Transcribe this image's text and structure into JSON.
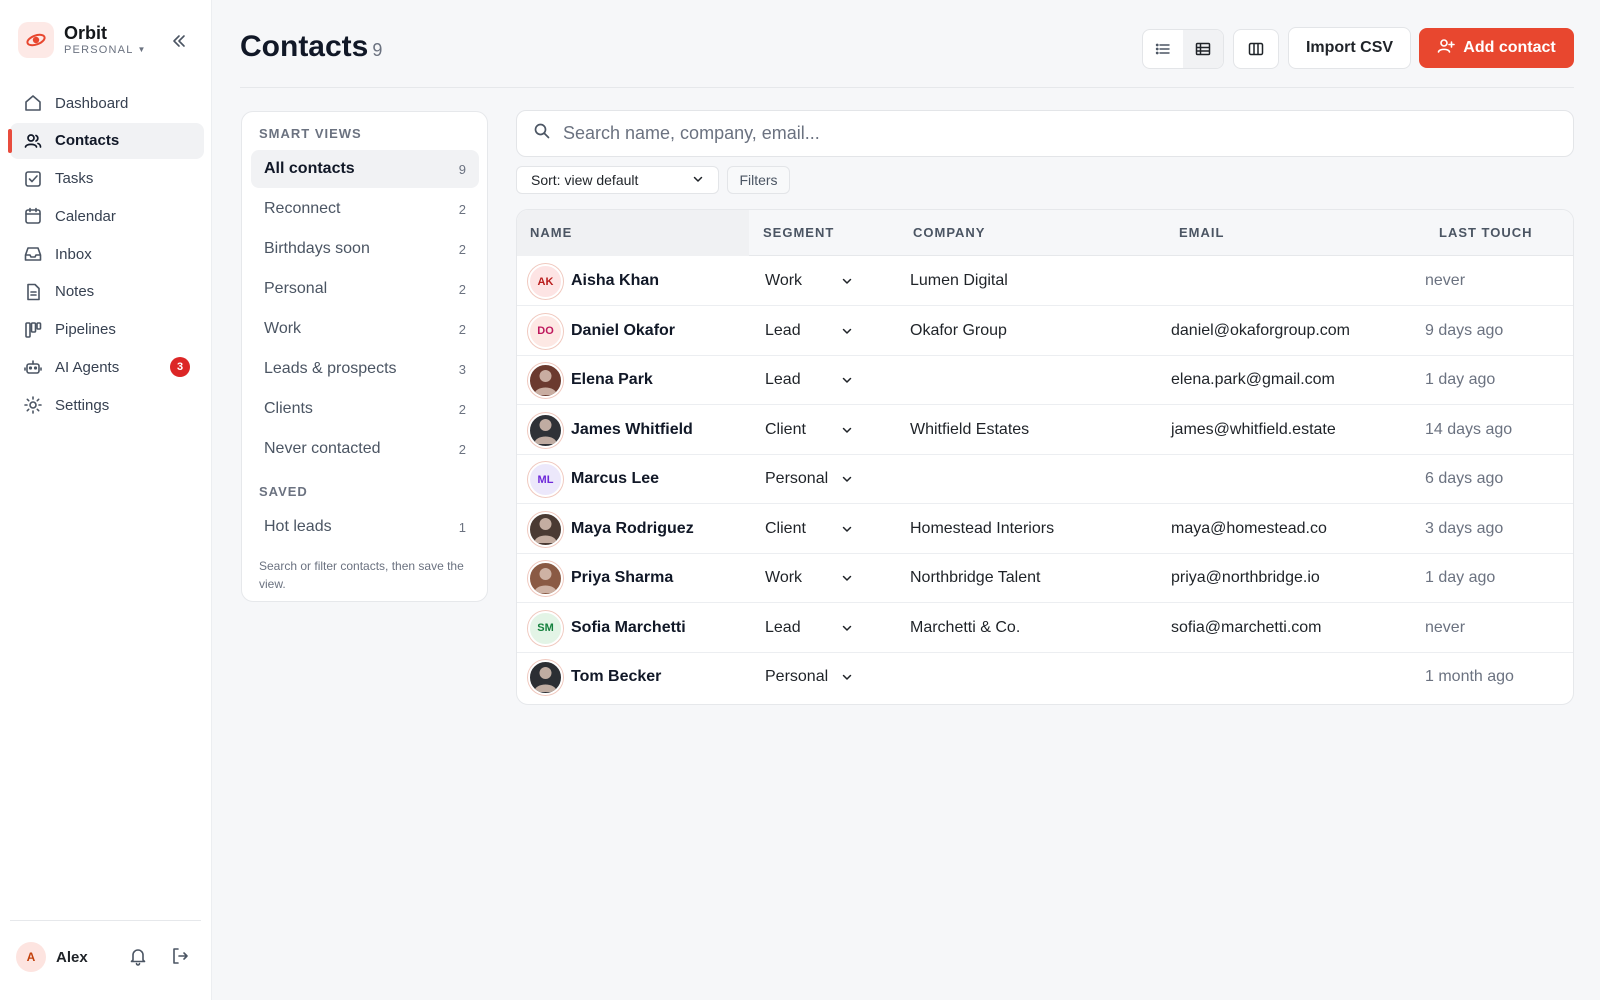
{
  "app": {
    "name": "Orbit",
    "workspace": "PERSONAL",
    "accent": "#e8472f"
  },
  "sidebar": {
    "items": [
      {
        "label": "Dashboard",
        "icon": "home-icon"
      },
      {
        "label": "Contacts",
        "icon": "users-icon",
        "active": true
      },
      {
        "label": "Tasks",
        "icon": "checkbox-icon"
      },
      {
        "label": "Calendar",
        "icon": "calendar-icon"
      },
      {
        "label": "Inbox",
        "icon": "inbox-icon"
      },
      {
        "label": "Notes",
        "icon": "note-icon"
      },
      {
        "label": "Pipelines",
        "icon": "kanban-icon"
      },
      {
        "label": "AI Agents",
        "icon": "robot-icon",
        "badge": "3"
      },
      {
        "label": "Settings",
        "icon": "gear-icon"
      }
    ],
    "user": {
      "initial": "A",
      "name": "Alex"
    }
  },
  "header": {
    "title": "Contacts",
    "count": "9",
    "import_label": "Import CSV",
    "add_label": "Add contact"
  },
  "views": {
    "smart_heading": "SMART VIEWS",
    "smart": [
      {
        "label": "All contacts",
        "count": "9",
        "active": true
      },
      {
        "label": "Reconnect",
        "count": "2"
      },
      {
        "label": "Birthdays soon",
        "count": "2"
      },
      {
        "label": "Personal",
        "count": "2"
      },
      {
        "label": "Work",
        "count": "2"
      },
      {
        "label": "Leads & prospects",
        "count": "3"
      },
      {
        "label": "Clients",
        "count": "2"
      },
      {
        "label": "Never contacted",
        "count": "2"
      }
    ],
    "saved_heading": "SAVED",
    "saved": [
      {
        "label": "Hot leads",
        "count": "1"
      }
    ],
    "hint": "Search or filter contacts, then save the view."
  },
  "search": {
    "placeholder": "Search name, company, email...",
    "value": ""
  },
  "sort": {
    "label": "Sort: view default"
  },
  "filters": {
    "label": "Filters"
  },
  "table": {
    "headers": {
      "name": "NAME",
      "segment": "SEGMENT",
      "company": "COMPANY",
      "email": "EMAIL",
      "last": "LAST TOUCH"
    },
    "rows": [
      {
        "initials": "AK",
        "photo": false,
        "bg": "#fde4e4",
        "fg": "#b91c1c",
        "name": "Aisha Khan",
        "segment": "Work",
        "company": "Lumen Digital",
        "email": "",
        "last": "never"
      },
      {
        "initials": "DO",
        "photo": false,
        "bg": "#fde8e4",
        "fg": "#be185d",
        "name": "Daniel Okafor",
        "segment": "Lead",
        "company": "Okafor Group",
        "email": "daniel@okaforgroup.com",
        "last": "9 days ago"
      },
      {
        "initials": "",
        "photo": true,
        "bg": "#6b3a2f",
        "fg": "#ffffff",
        "name": "Elena Park",
        "segment": "Lead",
        "company": "",
        "email": "elena.park@gmail.com",
        "last": "1 day ago"
      },
      {
        "initials": "",
        "photo": true,
        "bg": "#2f3237",
        "fg": "#ffffff",
        "name": "James Whitfield",
        "segment": "Client",
        "company": "Whitfield Estates",
        "email": "james@whitfield.estate",
        "last": "14 days ago"
      },
      {
        "initials": "ML",
        "photo": false,
        "bg": "#ece8fb",
        "fg": "#6d28d9",
        "name": "Marcus Lee",
        "segment": "Personal",
        "company": "",
        "email": "",
        "last": "6 days ago"
      },
      {
        "initials": "",
        "photo": true,
        "bg": "#4a3a33",
        "fg": "#ffffff",
        "name": "Maya Rodriguez",
        "segment": "Client",
        "company": "Homestead Interiors",
        "email": "maya@homestead.co",
        "last": "3 days ago"
      },
      {
        "initials": "",
        "photo": true,
        "bg": "#8a5a44",
        "fg": "#ffffff",
        "name": "Priya Sharma",
        "segment": "Work",
        "company": "Northbridge Talent",
        "email": "priya@northbridge.io",
        "last": "1 day ago"
      },
      {
        "initials": "SM",
        "photo": false,
        "bg": "#e3f4e6",
        "fg": "#15803d",
        "name": "Sofia Marchetti",
        "segment": "Lead",
        "company": "Marchetti & Co.",
        "email": "sofia@marchetti.com",
        "last": "never"
      },
      {
        "initials": "",
        "photo": true,
        "bg": "#2b2e33",
        "fg": "#ffffff",
        "name": "Tom Becker",
        "segment": "Personal",
        "company": "",
        "email": "",
        "last": "1 month ago"
      }
    ]
  }
}
